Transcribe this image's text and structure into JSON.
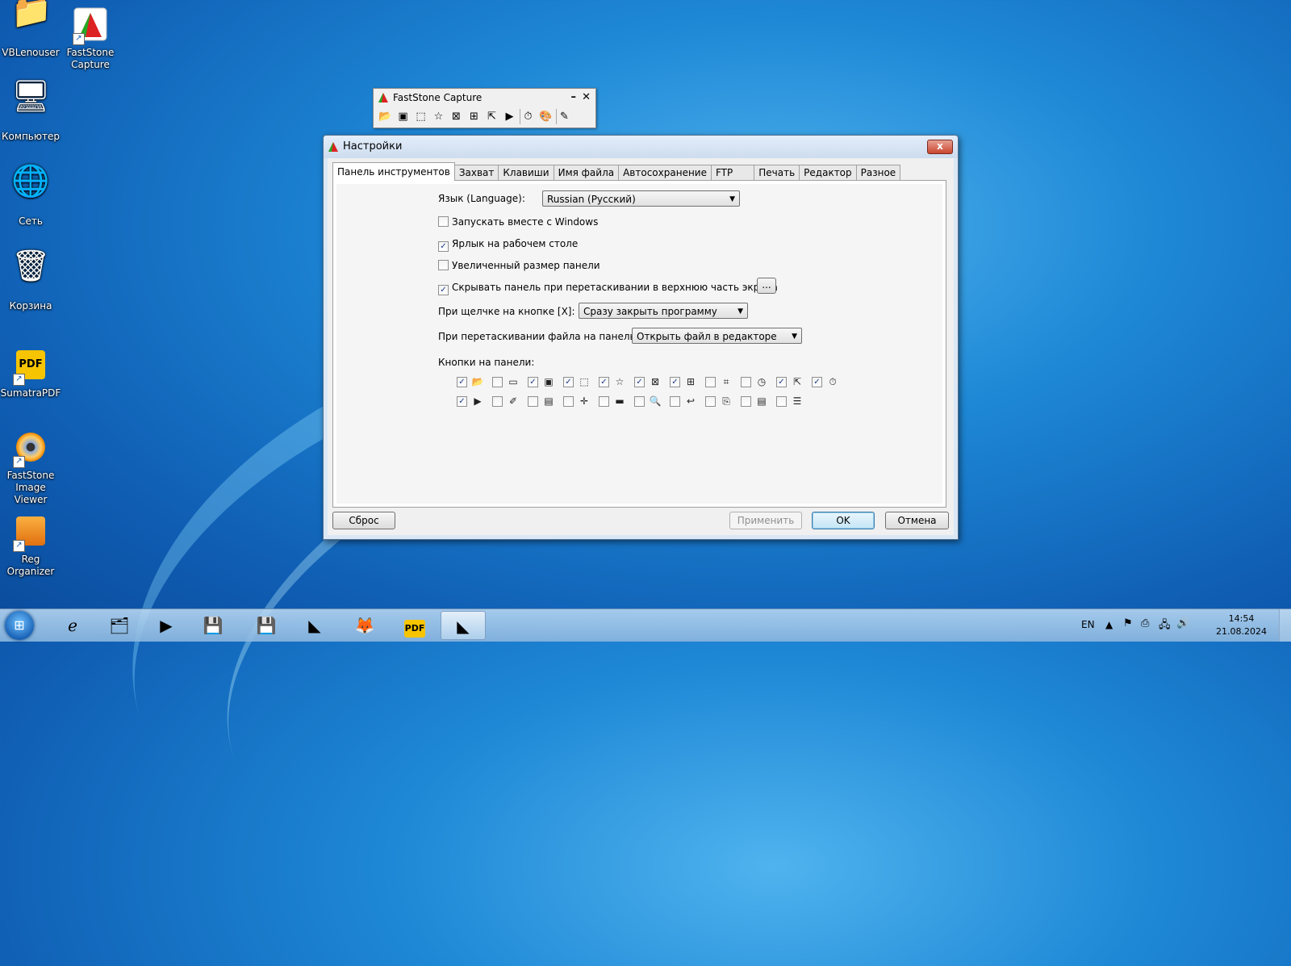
{
  "desktop": {
    "icons": [
      {
        "label": "VBLenouser",
        "glyph": "📁",
        "shortcut": false
      },
      {
        "label": "FastStone Capture",
        "glyph": "◣",
        "shortcut": true
      },
      {
        "label": "Компьютер",
        "glyph": "🖥",
        "shortcut": false
      },
      {
        "label": "Сеть",
        "glyph": "🌐",
        "shortcut": false
      },
      {
        "label": "Корзина",
        "glyph": "🗑",
        "shortcut": false
      },
      {
        "label": "SumatraPDF",
        "glyph": "PDF",
        "shortcut": true
      },
      {
        "label": "FastStone Image Viewer",
        "glyph": "👁",
        "shortcut": true
      },
      {
        "label": "Reg Organizer",
        "glyph": "🗂",
        "shortcut": true
      }
    ]
  },
  "capture_bar": {
    "title": "FastStone Capture",
    "minimize": "–",
    "close": "✕",
    "tools": [
      {
        "name": "open-icon",
        "glyph": "📂"
      },
      {
        "name": "capture-window-icon",
        "glyph": "▣"
      },
      {
        "name": "capture-rect-icon",
        "glyph": "⬚"
      },
      {
        "name": "capture-freehand-icon",
        "glyph": "☆"
      },
      {
        "name": "capture-fullscreen-icon",
        "glyph": "⊠"
      },
      {
        "name": "capture-scroll-icon",
        "glyph": "⊞"
      },
      {
        "name": "capture-fixed-icon",
        "glyph": "⇱"
      },
      {
        "name": "screen-record-icon",
        "glyph": "▶"
      },
      {
        "name": "timer-icon",
        "glyph": "⏱"
      },
      {
        "name": "output-icon",
        "glyph": "🎨"
      },
      {
        "name": "settings-icon",
        "glyph": "✎"
      }
    ]
  },
  "dialog": {
    "title": "Настройки",
    "close": "x",
    "tabs": [
      "Панель инструментов",
      "Захват",
      "Клавиши",
      "Имя файла",
      "Автосохранение",
      "FTP",
      "Печать",
      "Редактор",
      "Разное"
    ],
    "language_label": "Язык (Language):",
    "language_value": "Russian (Русский)",
    "options": [
      {
        "label": "Запускать вместе с Windows",
        "checked": false
      },
      {
        "label": "Ярлык на рабочем столе",
        "checked": true
      },
      {
        "label": "Увеличенный размер панели",
        "checked": false
      },
      {
        "label": "Скрывать панель при перетаскивании в верхнюю часть экрана",
        "checked": true
      }
    ],
    "more_button": "...",
    "close_click_label": "При щелчке на кнопке [X]:",
    "close_click_value": "Сразу закрыть программу",
    "drop_label": "При перетаскивании файла на панель:",
    "drop_value": "Открыть файл в редакторе",
    "buttons_label": "Кнопки на панели:",
    "panel_buttons_row1": [
      {
        "name": "open-icon",
        "glyph": "📂",
        "checked": true
      },
      {
        "name": "window-icon",
        "glyph": "▭",
        "checked": false
      },
      {
        "name": "capture-window-icon",
        "glyph": "▣",
        "checked": true
      },
      {
        "name": "capture-rect-icon",
        "glyph": "⬚",
        "checked": true
      },
      {
        "name": "capture-freehand-icon",
        "glyph": "☆",
        "checked": true
      },
      {
        "name": "capture-fullscreen-icon",
        "glyph": "⊠",
        "checked": true
      },
      {
        "name": "capture-scroll-icon",
        "glyph": "⊞",
        "checked": true
      },
      {
        "name": "capture-fixed-icon",
        "glyph": "⌗",
        "checked": false
      },
      {
        "name": "delay-icon",
        "glyph": "◷",
        "checked": false
      },
      {
        "name": "capture-menu-icon",
        "glyph": "⇱",
        "checked": true
      },
      {
        "name": "timer-icon",
        "glyph": "⏱",
        "checked": true
      }
    ],
    "panel_buttons_row2": [
      {
        "name": "screen-record-icon",
        "glyph": "▶",
        "checked": true
      },
      {
        "name": "color-picker-icon",
        "glyph": "✐",
        "checked": false
      },
      {
        "name": "ruler-icon",
        "glyph": "▤",
        "checked": false
      },
      {
        "name": "crosshair-icon",
        "glyph": "✛",
        "checked": false
      },
      {
        "name": "minus-icon",
        "glyph": "▬",
        "checked": false
      },
      {
        "name": "magnifier-icon",
        "glyph": "🔍",
        "checked": false
      },
      {
        "name": "undo-icon",
        "glyph": "↩",
        "checked": false
      },
      {
        "name": "scanner-icon",
        "glyph": "⎘",
        "checked": false
      },
      {
        "name": "pdf-icon",
        "glyph": "▤",
        "checked": false
      },
      {
        "name": "screen-split-icon",
        "glyph": "☰",
        "checked": false
      }
    ],
    "reset_button": "Сброс",
    "apply_button": "Применить",
    "ok_button": "OK",
    "cancel_button": "Отмена"
  },
  "taskbar": {
    "items": [
      {
        "name": "ie-icon",
        "glyph": "ℯ"
      },
      {
        "name": "explorer-icon",
        "glyph": "🗂"
      },
      {
        "name": "media-player-icon",
        "glyph": "▶"
      },
      {
        "name": "save-app-icon-1",
        "glyph": "💾"
      },
      {
        "name": "save-app-icon-2",
        "glyph": "💾"
      },
      {
        "name": "faststone-capture-icon",
        "glyph": "◣"
      },
      {
        "name": "firefox-icon",
        "glyph": "🦊"
      },
      {
        "name": "sumatrapdf-icon",
        "glyph": "PDF"
      },
      {
        "name": "faststone-active-icon",
        "glyph": "◣"
      }
    ],
    "language": "EN",
    "time": "14:54",
    "date": "21.08.2024"
  }
}
